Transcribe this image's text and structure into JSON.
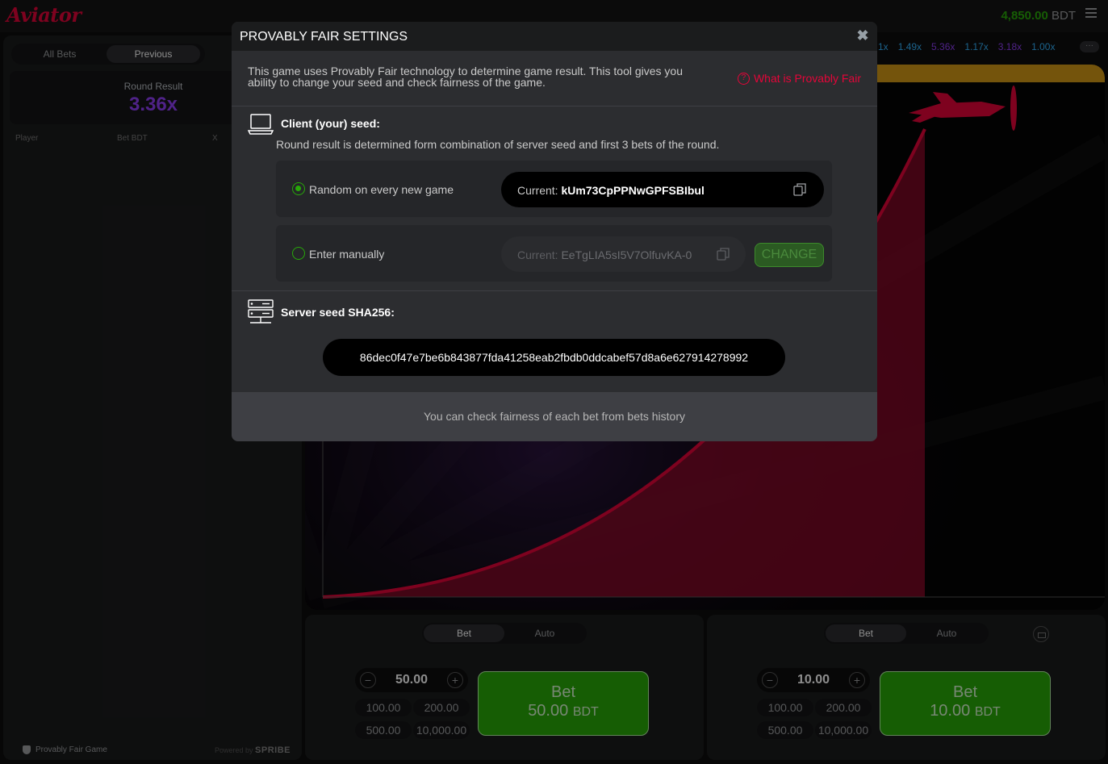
{
  "header": {
    "logo": "Aviator",
    "balance_amount": "4,850.00",
    "balance_currency": "BDT"
  },
  "left_panel": {
    "tabs": [
      {
        "label": "All Bets"
      },
      {
        "label": "Previous"
      }
    ],
    "round_result_label": "Round Result",
    "round_result_value": "3.36x",
    "columns": {
      "player": "Player",
      "bet": "Bet BDT",
      "x": "X"
    },
    "footer_provably": "Provably Fair Game",
    "footer_powered": "Powered by",
    "footer_brand": "SPRIBE"
  },
  "history": [
    "1x",
    "1.49x",
    "5.36x",
    "1.17x",
    "3.18x",
    "1.00x"
  ],
  "bet_panels": [
    {
      "tab_bet": "Bet",
      "tab_auto": "Auto",
      "amount": "50.00",
      "quick": [
        "100.00",
        "200.00",
        "500.00",
        "10,000.00"
      ],
      "bet_label": "Bet",
      "bet_amount": "50.00",
      "bet_currency": "BDT"
    },
    {
      "tab_bet": "Bet",
      "tab_auto": "Auto",
      "amount": "10.00",
      "quick": [
        "100.00",
        "200.00",
        "500.00",
        "10,000.00"
      ],
      "bet_label": "Bet",
      "bet_amount": "10.00",
      "bet_currency": "BDT"
    }
  ],
  "modal": {
    "title": "PROVABLY FAIR SETTINGS",
    "intro_line1": "This game uses Provably Fair technology to determine game result. This tool gives you",
    "intro_line2": "ability to change your seed and check fairness of the game.",
    "what_link": "What is Provably Fair",
    "client_title": "Client (your) seed:",
    "client_desc": "Round result is determined form combination of server seed and first 3 bets of the round.",
    "option_random": "Random on every new game",
    "current_label": "Current:",
    "random_seed": "kUm73CpPPNwGPFSBIbul",
    "option_manual": "Enter manually",
    "manual_seed": "EeTgLIA5sI5V7OlfuvKA-0",
    "change_label": "CHANGE",
    "server_title": "Server seed SHA256:",
    "server_hash": "86dec0f47e7be6b843877fda41258eab2fbdb0ddcabef57d8a6e627914278992",
    "footer": "You can check fairness of each bet from bets history"
  }
}
